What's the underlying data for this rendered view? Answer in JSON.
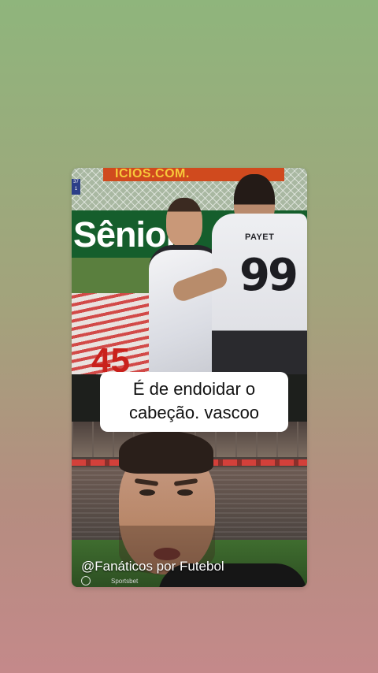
{
  "story": {
    "top_frame": {
      "top_ad_text": "ÍCIOS.COM.",
      "board_ad_text": "Sênior",
      "board_number": "45",
      "scorebug": [
        "37",
        "1"
      ],
      "player_name": "PAYET",
      "player_number": "99"
    },
    "caption": {
      "line1": "É de endoidar o",
      "line2": "cabeção.  vascoo"
    },
    "bottom_frame": {
      "watermark": "@Fanáticos por Futebol",
      "shirt_logo": "Sportsbet"
    }
  }
}
